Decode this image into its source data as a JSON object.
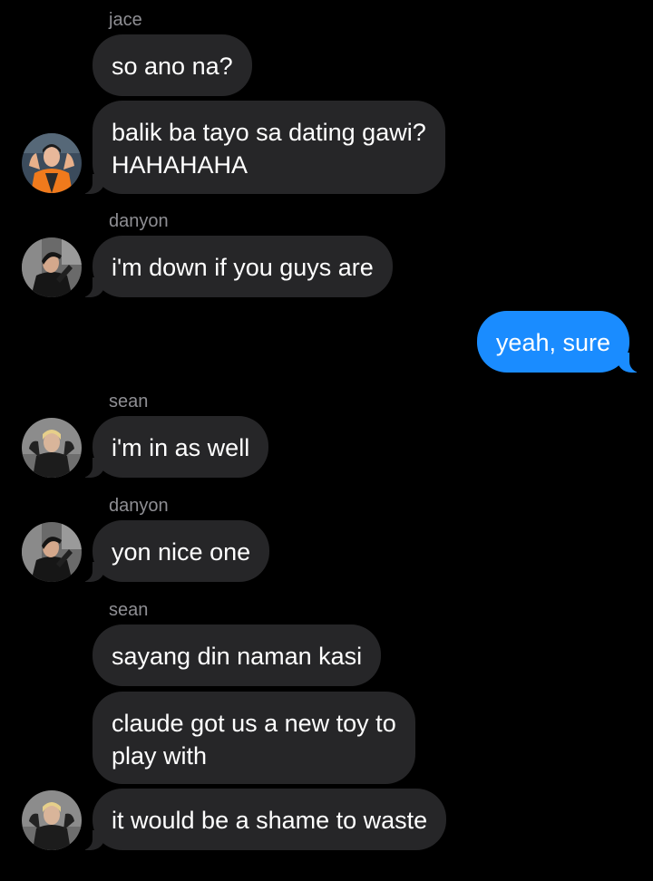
{
  "conversation": {
    "messages": [
      {
        "sender": "jace",
        "text": "so ano na?"
      },
      {
        "text": "balik ba tayo sa dating gawi?"
      },
      {
        "text": "HAHAHAHA"
      },
      {
        "sender": "danyon",
        "text": "i'm down if you guys are"
      },
      {
        "text": "yeah, sure",
        "outgoing": true
      },
      {
        "sender": "sean",
        "text": "i'm in as well"
      },
      {
        "sender": "danyon",
        "text": "yon nice one"
      },
      {
        "sender": "sean",
        "text": "sayang din naman kasi"
      },
      {
        "text": "claude got us a new toy to"
      },
      {
        "text": "play with"
      },
      {
        "text": "it would be a shame to waste"
      }
    ]
  },
  "avatars": {
    "jace": {
      "icon": "person-photo-icon",
      "bg_color": "#3a4a5a",
      "shirt_color": "#f07a1c"
    },
    "danyon": {
      "icon": "person-photo-icon",
      "bg_color": "#5a5a5a",
      "shirt_color": "#1a1a1a"
    },
    "sean": {
      "icon": "person-photo-icon",
      "bg_color": "#8a8a8a",
      "shirt_color": "#1c1c1c"
    }
  },
  "colors": {
    "background": "#000000",
    "incoming_bubble": "#262628",
    "outgoing_bubble": "#1a8cff",
    "sender_name": "#8e8e93",
    "text": "#ffffff"
  }
}
